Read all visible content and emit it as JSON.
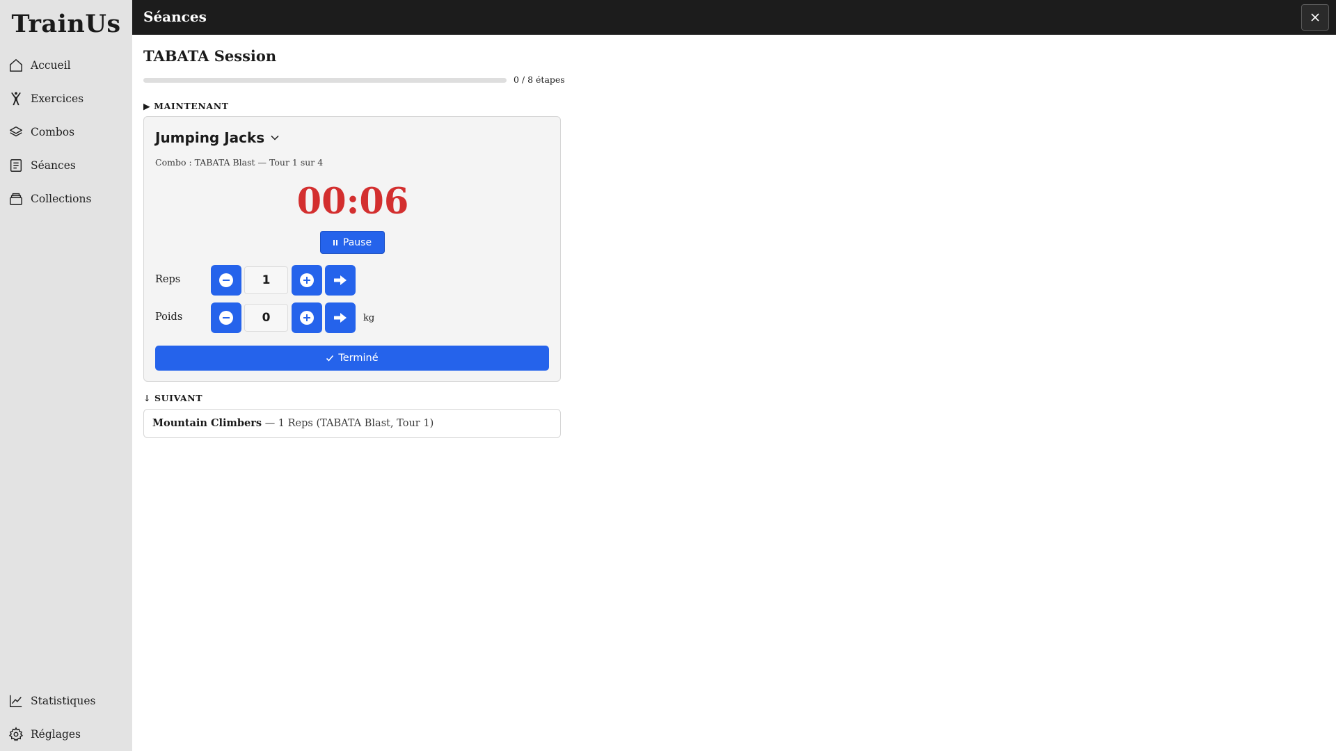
{
  "app": {
    "brand": "TrainUs"
  },
  "sidebar": {
    "items": [
      {
        "label": "Accueil",
        "icon": "home-icon"
      },
      {
        "label": "Exercices",
        "icon": "exercise-figure-icon"
      },
      {
        "label": "Combos",
        "icon": "layers-icon"
      },
      {
        "label": "Séances",
        "icon": "session-list-icon"
      },
      {
        "label": "Collections",
        "icon": "collection-stack-icon"
      }
    ],
    "bottom_items": [
      {
        "label": "Statistiques",
        "icon": "chart-line-icon"
      },
      {
        "label": "Réglages",
        "icon": "gear-icon"
      }
    ]
  },
  "topbar": {
    "title": "Séances",
    "close_icon": "close-icon"
  },
  "session": {
    "title": "TABATA Session",
    "progress_text": "0 / 8 étapes",
    "progress_fraction": 0,
    "now_label": "▶ MAINTENANT",
    "next_label": "↓ SUIVANT"
  },
  "current": {
    "exercise": "Jumping Jacks",
    "combo_line": "Combo : TABATA Blast — Tour 1 sur 4",
    "timer": "00:06",
    "pause_label": "Pause",
    "reps_label": "Reps",
    "reps_value": "1",
    "weight_label": "Poids",
    "weight_value": "0",
    "weight_unit": "kg",
    "done_label": "Terminé"
  },
  "next": {
    "exercise": "Mountain Climbers",
    "details": "— 1 Reps (TABATA Blast, Tour 1)"
  },
  "colors": {
    "accent": "#2563eb",
    "timer": "#d32f2f",
    "sidebar_bg": "#e3e3e3",
    "topbar_bg": "#1c1c1c"
  }
}
